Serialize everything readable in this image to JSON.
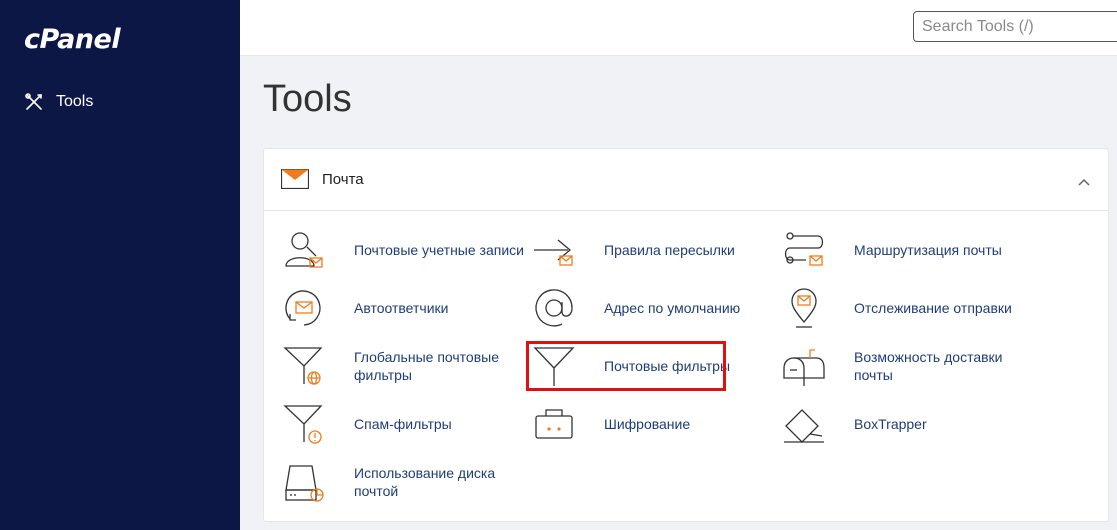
{
  "sidebar": {
    "logo": "cPanel",
    "nav_tools_label": "Tools"
  },
  "search": {
    "placeholder": "Search Tools (/)",
    "value": ""
  },
  "page": {
    "title": "Tools"
  },
  "section": {
    "title": "Почта",
    "collapsed": false
  },
  "tools": [
    {
      "label": "Почтовые учетные записи",
      "icon": "email-accounts-icon"
    },
    {
      "label": "Правила пересылки",
      "icon": "forwarders-icon"
    },
    {
      "label": "Маршрутизация почты",
      "icon": "email-routing-icon"
    },
    {
      "label": "Автоответчики",
      "icon": "autoresponders-icon"
    },
    {
      "label": "Адрес по умолчанию",
      "icon": "at-sign-icon"
    },
    {
      "label": "Отслеживание отправки",
      "icon": "track-delivery-icon"
    },
    {
      "label": "Глобальные почтовые фильтры",
      "icon": "global-filter-icon"
    },
    {
      "label": "Почтовые фильтры",
      "icon": "email-filter-icon",
      "highlighted": true
    },
    {
      "label": "Возможность доставки почты",
      "icon": "mailbox-icon"
    },
    {
      "label": "Спам-фильтры",
      "icon": "spam-filter-icon"
    },
    {
      "label": "Шифрование",
      "icon": "encryption-icon"
    },
    {
      "label": "BoxTrapper",
      "icon": "boxtrapper-icon"
    },
    {
      "label": "Использование диска почтой",
      "icon": "disk-usage-icon"
    }
  ],
  "colors": {
    "sidebar": "#0c1745",
    "link": "#1f3d7a",
    "accent": "#f07c1e",
    "highlight": "#e01010"
  }
}
